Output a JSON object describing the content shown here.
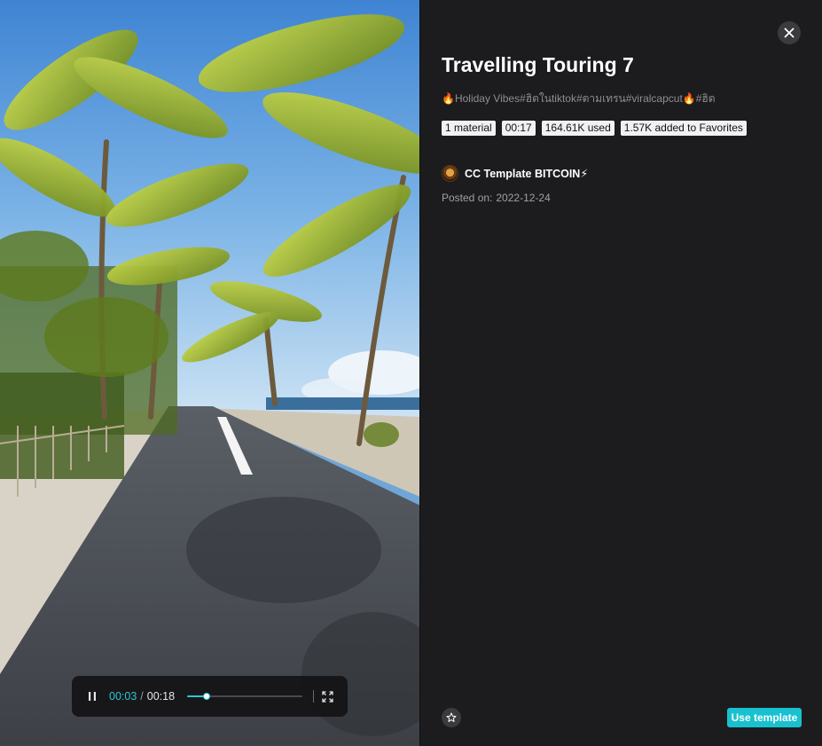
{
  "video": {
    "player": {
      "current_time": "00:03",
      "separator": "/",
      "duration": "00:18",
      "progress_fraction": 0.17,
      "accent_color": "#2cc6d6"
    },
    "icons": {
      "pause": "pause-icon",
      "fullscreen": "fullscreen-icon"
    }
  },
  "panel": {
    "close_icon": "close-icon",
    "title": "Travelling Touring 7",
    "tags": {
      "fire1": "🔥",
      "text1": "Holiday Vibes#ฮิตในtiktok#ตามเทรน#viralcapcut",
      "fire2": "🔥",
      "text2": "#ฮิต"
    },
    "badges": [
      "1 material",
      "00:17",
      "164.61K used",
      "1.57K added to Favorites"
    ],
    "author": {
      "name": "CC Template BITCOIN⚡"
    },
    "posted": {
      "label": "Posted on:",
      "date": "2022-12-24"
    },
    "favorite_icon": "star-icon",
    "use_template_label": "Use template",
    "accent_color": "#18c1cf"
  }
}
